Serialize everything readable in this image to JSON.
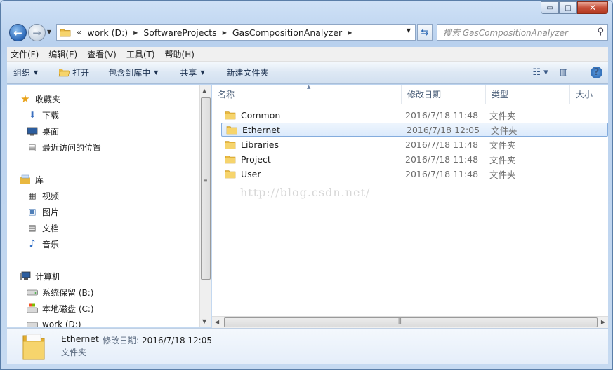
{
  "window": {
    "caption_buttons": {
      "minimize": "▭",
      "maximize": "□",
      "close": "✕"
    }
  },
  "address_bar": {
    "overflow_chevron": "«",
    "crumbs": [
      "work (D:)",
      "SoftwareProjects",
      "GasCompositionAnalyzer"
    ]
  },
  "search": {
    "placeholder": "搜索 GasCompositionAnalyzer"
  },
  "menu": [
    "文件(F)",
    "编辑(E)",
    "查看(V)",
    "工具(T)",
    "帮助(H)"
  ],
  "toolbar": {
    "organize": "组织",
    "open": "打开",
    "include_in_library": "包含到库中",
    "share": "共享",
    "new_folder": "新建文件夹"
  },
  "nav_pane": {
    "favorites": {
      "label": "收藏夹",
      "items": [
        "下载",
        "桌面",
        "最近访问的位置"
      ]
    },
    "libraries": {
      "label": "库",
      "items": [
        "视频",
        "图片",
        "文档",
        "音乐"
      ]
    },
    "computer": {
      "label": "计算机",
      "items": [
        "系统保留 (B:)",
        "本地磁盘 (C:)",
        "work (D:)"
      ]
    }
  },
  "columns": {
    "name": "名称",
    "date": "修改日期",
    "type": "类型",
    "size": "大小"
  },
  "files": [
    {
      "name": "Common",
      "date": "2016/7/18 11:48",
      "type": "文件夹"
    },
    {
      "name": "Ethernet",
      "date": "2016/7/18 12:05",
      "type": "文件夹",
      "selected": true
    },
    {
      "name": "Libraries",
      "date": "2016/7/18 11:48",
      "type": "文件夹"
    },
    {
      "name": "Project",
      "date": "2016/7/18 11:48",
      "type": "文件夹"
    },
    {
      "name": "User",
      "date": "2016/7/18 11:48",
      "type": "文件夹"
    }
  ],
  "watermark": "http://blog.csdn.net/",
  "details": {
    "name": "Ethernet",
    "modified_label": "修改日期:",
    "modified_value": "2016/7/18 12:05",
    "type": "文件夹"
  },
  "colors": {
    "accent": "#2b68b8",
    "selection": "#dbeafc",
    "folder": "#f2c14e"
  }
}
